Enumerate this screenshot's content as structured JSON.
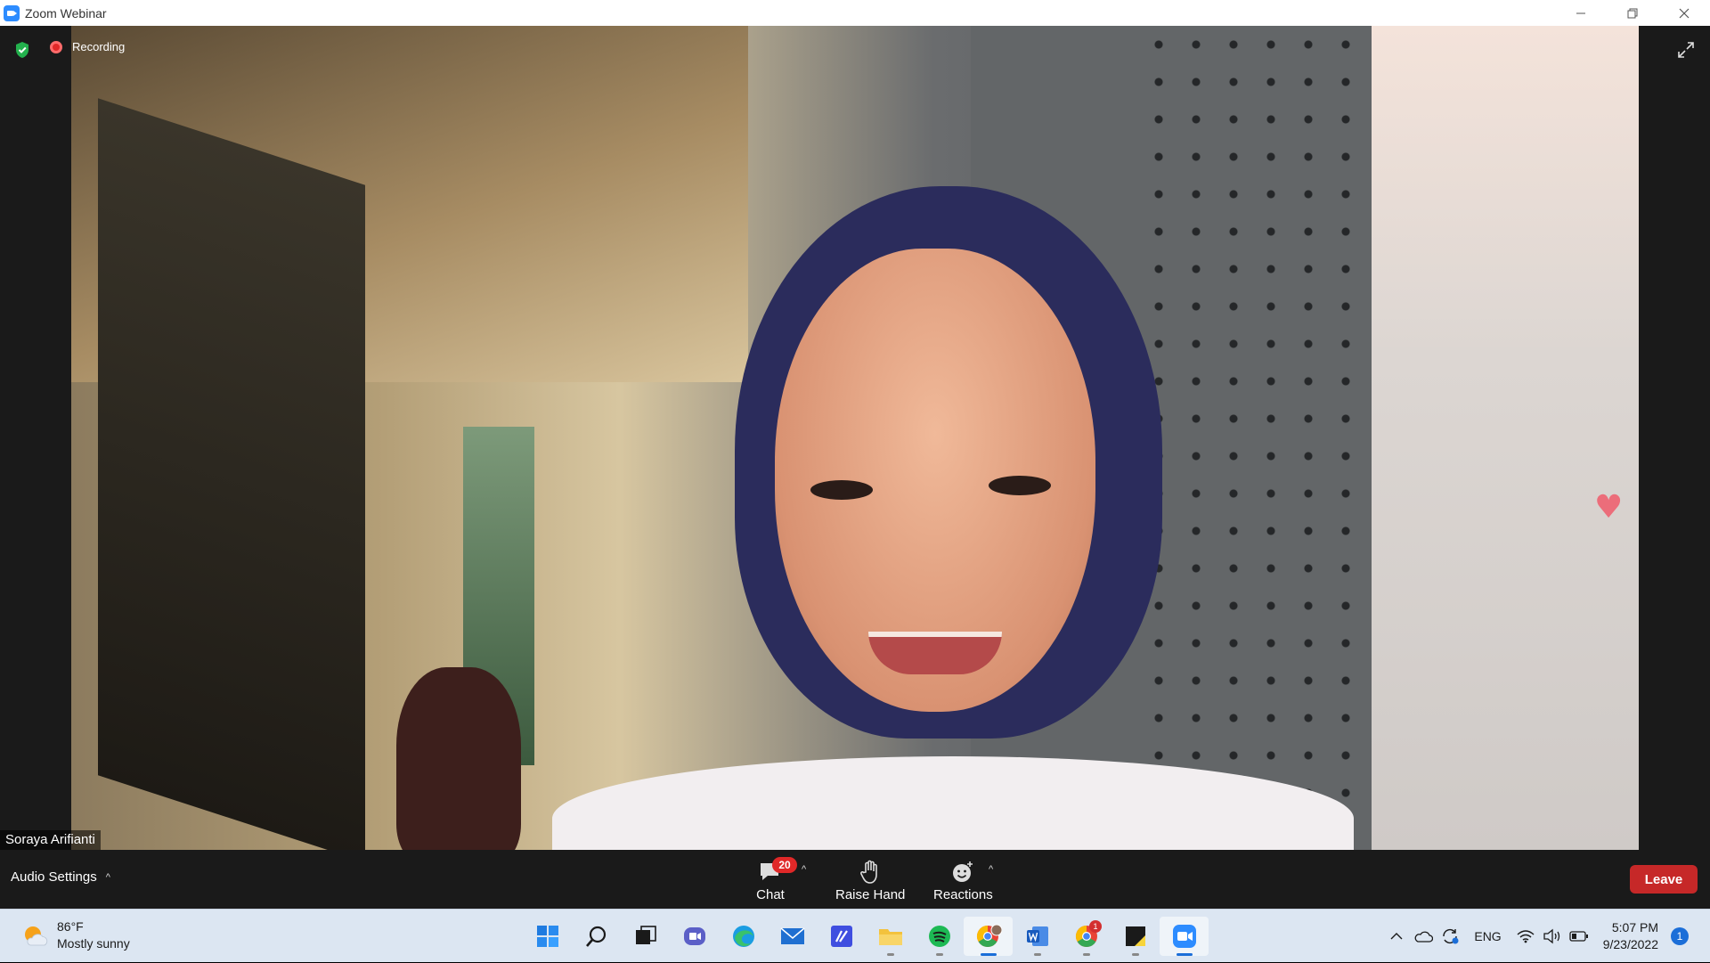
{
  "window": {
    "title": "Zoom Webinar",
    "controls": [
      "minimize",
      "restore",
      "close"
    ]
  },
  "meeting": {
    "recording_label": "Recording",
    "speaker_name": "Soraya Arifianti",
    "security_icon": "shield-check-icon",
    "fullscreen_icon": "expand-icon",
    "reaction_icon": "heart-icon"
  },
  "toolbar": {
    "audio_settings_label": "Audio Settings",
    "chat_label": "Chat",
    "chat_badge": "20",
    "raise_hand_label": "Raise Hand",
    "reactions_label": "Reactions",
    "leave_label": "Leave",
    "colors": {
      "leave": "#c62828",
      "badge": "#e02828"
    }
  },
  "taskbar": {
    "weather_temp": "86°F",
    "weather_desc": "Mostly sunny",
    "apps": [
      {
        "name": "start-icon"
      },
      {
        "name": "search-icon"
      },
      {
        "name": "task-view-icon"
      },
      {
        "name": "teams-chat-icon"
      },
      {
        "name": "edge-icon"
      },
      {
        "name": "mail-icon"
      },
      {
        "name": "visual-studio-icon"
      },
      {
        "name": "file-explorer-icon"
      },
      {
        "name": "spotify-icon"
      },
      {
        "name": "chrome-profile-icon"
      },
      {
        "name": "word-icon"
      },
      {
        "name": "chrome-icon",
        "badge": "1"
      },
      {
        "name": "sticky-notes-icon"
      },
      {
        "name": "zoom-icon"
      }
    ],
    "language": "ENG",
    "time": "5:07 PM",
    "date": "9/23/2022",
    "notification_count": "1"
  }
}
